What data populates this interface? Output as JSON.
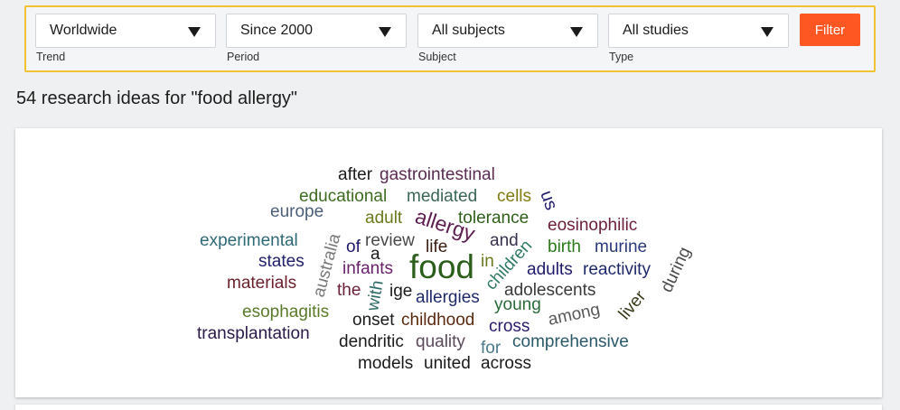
{
  "filters": {
    "trend": {
      "value": "Worldwide",
      "label": "Trend"
    },
    "period": {
      "value": "Since 2000",
      "label": "Period"
    },
    "subject": {
      "value": "All subjects",
      "label": "Subject"
    },
    "type": {
      "value": "All studies",
      "label": "Type"
    },
    "filter_button_label": "Filter"
  },
  "results_heading": "54 research ideas for \"food allergy\"",
  "word_cloud": {
    "words": [
      {
        "text": "after",
        "color": "#1b1b1b"
      },
      {
        "text": "gastrointestinal",
        "color": "#5a2c52"
      },
      {
        "text": "educational",
        "color": "#3d6b1f"
      },
      {
        "text": "mediated",
        "color": "#3a6655"
      },
      {
        "text": "cells",
        "color": "#7f7a12"
      },
      {
        "text": "us",
        "color": "#1f1a6b"
      },
      {
        "text": "europe",
        "color": "#4c5f7a"
      },
      {
        "text": "adult",
        "color": "#6a7a1e"
      },
      {
        "text": "allergy",
        "color": "#5c1c4e"
      },
      {
        "text": "tolerance",
        "color": "#2f5e1a"
      },
      {
        "text": "eosinophilic",
        "color": "#6b1f3a"
      },
      {
        "text": "experimental",
        "color": "#2e6a76"
      },
      {
        "text": "australia",
        "color": "#7a7a7a"
      },
      {
        "text": "of",
        "color": "#1f1a6b"
      },
      {
        "text": "review",
        "color": "#4a4a4a"
      },
      {
        "text": "life",
        "color": "#3a1a10"
      },
      {
        "text": "and",
        "color": "#3a3050"
      },
      {
        "text": "birth",
        "color": "#2a7a1a"
      },
      {
        "text": "murine",
        "color": "#2a3a7a"
      },
      {
        "text": "a",
        "color": "#1b1b1b"
      },
      {
        "text": "food",
        "color": "#2a5e1a"
      },
      {
        "text": "children",
        "color": "#2e7a66"
      },
      {
        "text": "during",
        "color": "#4a4a4a"
      },
      {
        "text": "states",
        "color": "#20206b"
      },
      {
        "text": "infants",
        "color": "#6a1f6b"
      },
      {
        "text": "in",
        "color": "#6a7a1e"
      },
      {
        "text": "adults",
        "color": "#1f1a6b"
      },
      {
        "text": "reactivity",
        "color": "#1f2a6b"
      },
      {
        "text": "materials",
        "color": "#6b1f2a"
      },
      {
        "text": "the",
        "color": "#6b1f3a"
      },
      {
        "text": "with",
        "color": "#2e6a66"
      },
      {
        "text": "ige",
        "color": "#1b1b1b"
      },
      {
        "text": "allergies",
        "color": "#1f2a6b"
      },
      {
        "text": "adolescents",
        "color": "#3a3a3a"
      },
      {
        "text": "liver",
        "color": "#3a3a1a"
      },
      {
        "text": "young",
        "color": "#2a6a3a"
      },
      {
        "text": "esophagitis",
        "color": "#5a7a2a"
      },
      {
        "text": "onset",
        "color": "#1b1b1b"
      },
      {
        "text": "childhood",
        "color": "#5a2a10"
      },
      {
        "text": "among",
        "color": "#5a5a5a"
      },
      {
        "text": "cross",
        "color": "#2a1a6b"
      },
      {
        "text": "transplantation",
        "color": "#2a1a4a"
      },
      {
        "text": "dendritic",
        "color": "#1b1b1b"
      },
      {
        "text": "quality",
        "color": "#5a4a5a"
      },
      {
        "text": "comprehensive",
        "color": "#2a5a6a"
      },
      {
        "text": "for",
        "color": "#4a7a8a"
      },
      {
        "text": "models",
        "color": "#1b1b1b"
      },
      {
        "text": "united",
        "color": "#1b1b1b"
      },
      {
        "text": "across",
        "color": "#1b1b1b"
      }
    ]
  }
}
